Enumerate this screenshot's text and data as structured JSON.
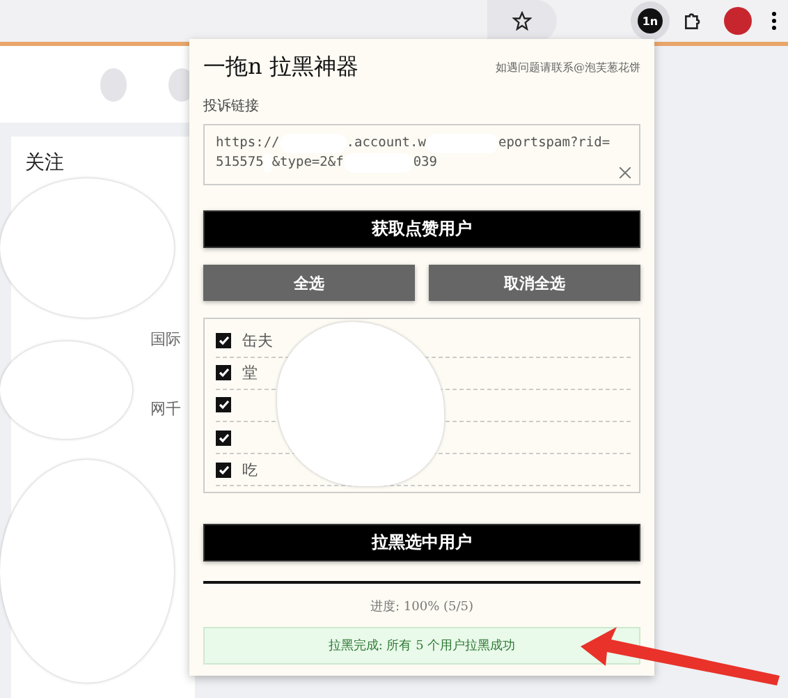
{
  "browser": {
    "extension_badge": "1n"
  },
  "page": {
    "heading": "关注",
    "fragments": [
      "国际",
      "网千"
    ]
  },
  "popup": {
    "title": "一拖n 拉黑神器",
    "contact": "如遇问题请联系@泡芙葱花饼",
    "link_label": "投诉链接",
    "link_lines": [
      [
        "https://",
        ".account.w",
        "eportspam?rid="
      ],
      [
        "515575",
        "&type=2&f",
        "039"
      ]
    ],
    "fetch_button": "获取点赞用户",
    "select_all": "全选",
    "deselect_all": "取消全选",
    "users": [
      {
        "name": "缶夫",
        "checked": true
      },
      {
        "name": "堂",
        "checked": true
      },
      {
        "checked": true
      },
      {
        "checked": true
      },
      {
        "name": "吃",
        "checked": true
      }
    ],
    "block_button": "拉黑选中用户",
    "progress": {
      "level": 1,
      "text": "进度: 100% (5/5)"
    },
    "status": "拉黑完成: 所有 5 个用户拉黑成功"
  }
}
